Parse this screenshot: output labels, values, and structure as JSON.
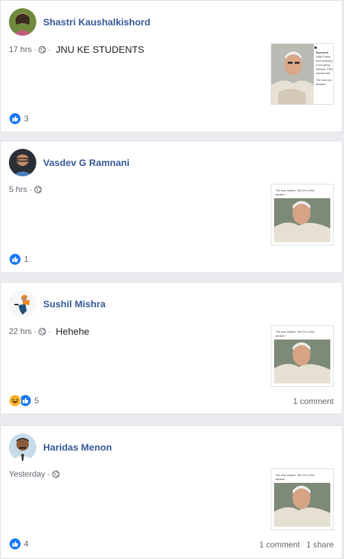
{
  "posts": [
    {
      "author": "Shastri Kaushalkishord",
      "time": "17 hrs",
      "text": "JNU KE STUDENTS",
      "thumb_lines": [
        "Bsouvera",
        "Delhi Police",
        "from entering",
        "is not going",
        "campus. Pare",
        "cannot visit.",
        "The man rep",
        "student.\""
      ],
      "reactions": [
        "like"
      ],
      "reaction_count": "3",
      "comments": "",
      "shares": ""
    },
    {
      "author": "Vasdev G Ramnani",
      "time": "5 hrs",
      "text": "",
      "thumb_lines": [
        "The man replied: \"But I'm a JNU",
        "student.\""
      ],
      "reactions": [
        "like"
      ],
      "reaction_count": "1",
      "comments": "",
      "shares": ""
    },
    {
      "author": "Sushil Mishra",
      "time": "22 hrs",
      "text": "Hehehe",
      "thumb_lines": [
        "The man replied: \"But I'm a JNU",
        "student.\""
      ],
      "reactions": [
        "haha",
        "like"
      ],
      "reaction_count": "5",
      "comments": "1 comment",
      "shares": ""
    },
    {
      "author": "Haridas Menon",
      "time": "Yesterday",
      "text": "",
      "thumb_lines": [
        "The man replied: \"But I'm a JNU",
        "student.\""
      ],
      "reactions": [
        "like"
      ],
      "reaction_count": "4",
      "comments": "1 comment",
      "shares": "1 share"
    }
  ],
  "colors": {
    "name": "#385898",
    "meta": "#606770",
    "like": "#1877f2",
    "haha": "#f7b125",
    "background": "#e9ebee"
  },
  "icons": {
    "privacy": "globe-icon",
    "like": "thumbs-up-icon",
    "haha": "laughing-face-icon"
  }
}
